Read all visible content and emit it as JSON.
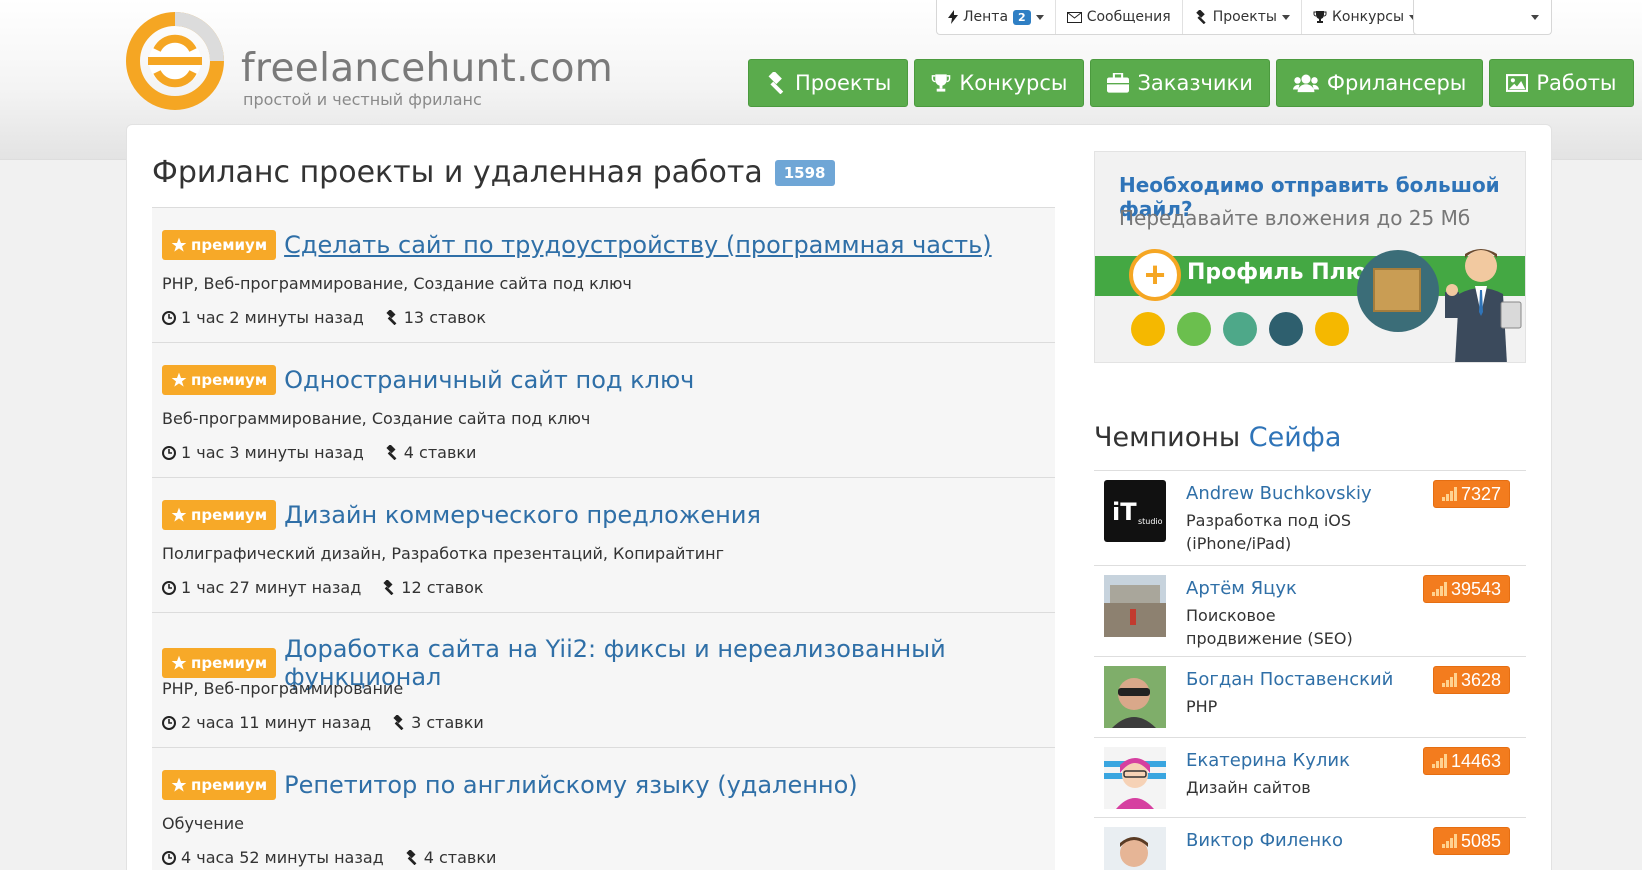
{
  "site": {
    "name": "freelancehunt.com",
    "tagline": "простой и честный фриланс"
  },
  "topbar": {
    "feed_label": "Лента",
    "feed_count": "2",
    "messages_label": "Сообщения",
    "projects_label": "Проекты",
    "contests_label": "Конкурсы"
  },
  "mainnav": {
    "projects": "Проекты",
    "contests": "Конкурсы",
    "clients": "Заказчики",
    "freelancers": "Фрилансеры",
    "works": "Работы"
  },
  "page": {
    "title": "Фриланс проекты и удаленная работа",
    "count": "1598"
  },
  "premium_label": "премиум",
  "projects": [
    {
      "title": "Сделать сайт по трудоустройству (программная часть)",
      "tags": "PHP, Веб-программирование, Создание сайта под ключ",
      "time": "1 час 2 минуты назад",
      "bids": "13 ставок"
    },
    {
      "title": "Одностраничный сайт под ключ",
      "tags": "Веб-программирование, Создание сайта под ключ",
      "time": "1 час 3 минуты назад",
      "bids": "4 ставки"
    },
    {
      "title": "Дизайн коммерческого предложения",
      "tags": "Полиграфический дизайн, Разработка презентаций, Копирайтинг",
      "time": "1 час 27 минут назад",
      "bids": "12 ставок"
    },
    {
      "title": "Доработка сайта на Yii2: фиксы и нереализованный функционал",
      "tags": "PHP, Веб-программирование",
      "time": "2 часа 11 минут назад",
      "bids": "3 ставки"
    },
    {
      "title": "Репетитор по английскому языку (удаленно)",
      "tags": "Обучение",
      "time": "4 часа 52 минуты назад",
      "bids": "4 ставки"
    }
  ],
  "banner": {
    "line1": "Необходимо отправить большой файл?",
    "line2": "Передавайте вложения до 25 Мб",
    "plan": "Профиль Плюс"
  },
  "champions": {
    "title_prefix": "Чемпионы",
    "title_accent": "Сейфа",
    "items": [
      {
        "name": "Andrew Buchkovskiy",
        "spec": "Разработка под iOS (iPhone/iPad)",
        "rating": "7327"
      },
      {
        "name": "Артём Яцук",
        "spec": "Поисковое продвижение (SEO)",
        "rating": "39543"
      },
      {
        "name": "Богдан Поставенский",
        "spec": "PHP",
        "rating": "3628"
      },
      {
        "name": "Екатерина Кулик",
        "spec": "Дизайн сайтов",
        "rating": "14463"
      },
      {
        "name": "Виктор Филенко",
        "spec": "",
        "rating": "5085"
      }
    ]
  },
  "colors": {
    "nav_green": "#5aab4c",
    "premium_orange": "#f7a928",
    "link_blue": "#2f6fa7",
    "rating_orange": "#f37c1e"
  }
}
